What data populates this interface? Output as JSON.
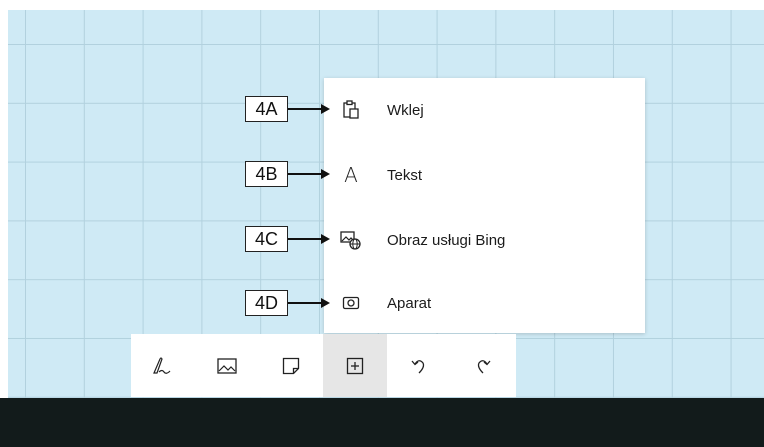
{
  "menu": {
    "items": [
      {
        "label": "Wklej",
        "icon": "paste-icon",
        "callout": "4A"
      },
      {
        "label": "Tekst",
        "icon": "text-icon",
        "callout": "4B"
      },
      {
        "label": "Obraz usługi Bing",
        "icon": "bing-image-icon",
        "callout": "4C"
      },
      {
        "label": "Aparat",
        "icon": "camera-icon",
        "callout": "4D"
      }
    ],
    "text_icon_glyph": "A"
  },
  "toolbar": {
    "buttons": [
      {
        "icon": "ink-pen-icon"
      },
      {
        "icon": "image-icon"
      },
      {
        "icon": "note-icon"
      },
      {
        "icon": "add-icon",
        "active": true
      },
      {
        "icon": "undo-icon"
      },
      {
        "icon": "redo-icon"
      }
    ]
  },
  "colors": {
    "canvas": "#cfeaf5",
    "grid": "#b2d1de",
    "taskbar": "#121b1b",
    "active_button": "#e6e6e6"
  }
}
